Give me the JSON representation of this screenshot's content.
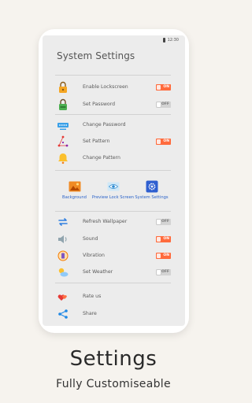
{
  "status_bar": {
    "time": "12:30"
  },
  "screen": {
    "title": "System Settings"
  },
  "group1": [
    {
      "label": "Enable Lockscreen",
      "icon": "lock-orange-icon",
      "toggle": "ON"
    },
    {
      "label": "Set Password",
      "icon": "lock-green-icon",
      "toggle": "OFF"
    }
  ],
  "group2": [
    {
      "label": "Change Password",
      "icon": "password-dots-icon"
    },
    {
      "label": "Set Pattern",
      "icon": "pattern-icon",
      "toggle": "ON"
    },
    {
      "label": "Change Pattern",
      "icon": "bell-icon"
    }
  ],
  "tiles": [
    {
      "label": "Background",
      "icon": "image-icon"
    },
    {
      "label": "Preview Lock Screen",
      "icon": "eye-icon"
    },
    {
      "label": "System Settings",
      "icon": "gear-icon"
    }
  ],
  "group3": [
    {
      "label": "Refresh Wallpaper",
      "icon": "refresh-icon",
      "toggle": "OFF"
    },
    {
      "label": "Sound",
      "icon": "speaker-icon",
      "toggle": "ON"
    },
    {
      "label": "Vibration",
      "icon": "vibration-icon",
      "toggle": "ON"
    },
    {
      "label": "Set Weather",
      "icon": "weather-icon",
      "toggle": "OFF"
    }
  ],
  "group4": [
    {
      "label": "Rate us",
      "icon": "hearts-icon"
    },
    {
      "label": "Share",
      "icon": "share-icon"
    }
  ],
  "caption": {
    "title": "Settings",
    "subtitle": "Fully Customiseable"
  },
  "colors": {
    "toggle_on": "#ff6b3d",
    "toggle_off": "#d3d3d3",
    "tile_label": "#2b63c9",
    "page_bg": "#f6f3ee"
  }
}
